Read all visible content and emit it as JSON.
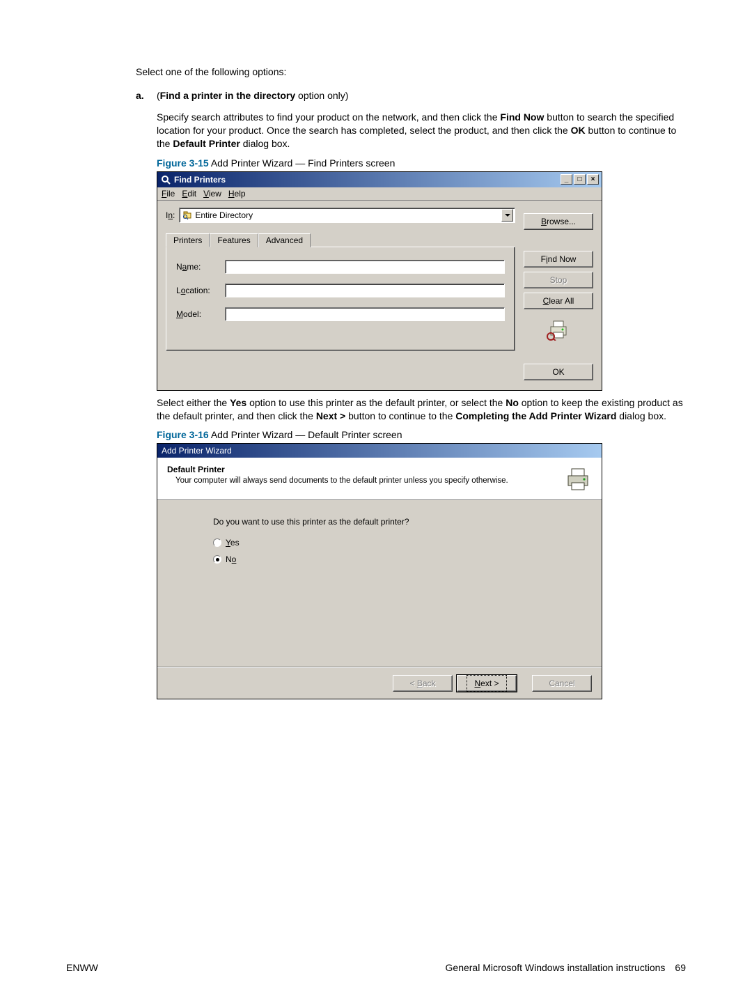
{
  "intro": "Select one of the following options:",
  "item_a": {
    "marker": "a.",
    "label_prefix": "(",
    "label_bold": "Find a printer in the directory",
    "label_suffix": " option only)"
  },
  "para_a1_parts": {
    "p1": "Specify search attributes to find your product on the network, and then click the ",
    "b1": "Find Now",
    "p2": " button to search the specified location for your product. Once the search has completed, select the product, and then click the ",
    "b2": "OK",
    "p3": " button to continue to the ",
    "b3": "Default Printer",
    "p4": " dialog box."
  },
  "fig315": {
    "ref": "Figure 3-15",
    "desc": "  Add Printer Wizard — Find Printers screen"
  },
  "find": {
    "title": "Find Printers",
    "menu": {
      "file": "File",
      "edit": "Edit",
      "view": "View",
      "help": "Help"
    },
    "in_label": "In:",
    "in_value": "Entire Directory",
    "browse": "Browse...",
    "tabs": {
      "printers": "Printers",
      "features": "Features",
      "advanced": "Advanced"
    },
    "fields": {
      "name": "Name:",
      "location": "Location:",
      "model": "Model:"
    },
    "btns": {
      "findnow": "Find Now",
      "stop": "Stop",
      "clearall": "Clear All",
      "ok": "OK"
    }
  },
  "para_a2_parts": {
    "p1": "Select either the ",
    "b1": "Yes",
    "p2": " option to use this printer as the default printer, or select the ",
    "b2": "No",
    "p3": " option to keep the existing product as the default printer, and then click the ",
    "b3": "Next >",
    "p4": " button to continue to the ",
    "b4": "Completing the Add Printer Wizard",
    "p5": " dialog box."
  },
  "fig316": {
    "ref": "Figure 3-16",
    "desc": "  Add Printer Wizard — Default Printer screen"
  },
  "wizard": {
    "title": "Add Printer Wizard",
    "header_title": "Default Printer",
    "header_sub": "Your computer will always send documents to the default printer unless you specify otherwise.",
    "question": "Do you want to use this printer as the default printer?",
    "opt_yes": "Yes",
    "opt_no": "No",
    "btn_back": "< Back",
    "btn_next": "Next >",
    "btn_cancel": "Cancel"
  },
  "footer": {
    "left": "ENWW",
    "right": "General Microsoft Windows installation instructions",
    "page": "69"
  }
}
